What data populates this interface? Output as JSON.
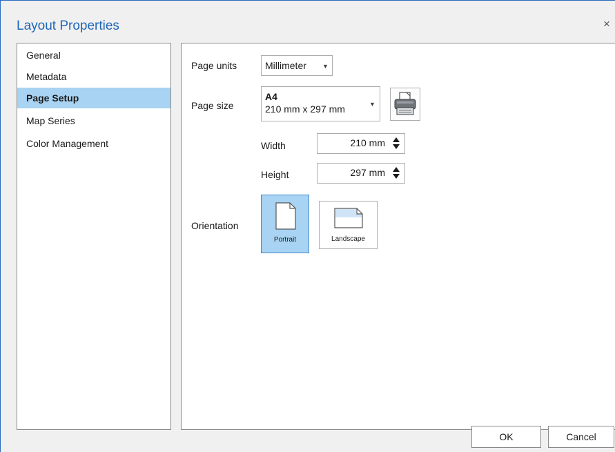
{
  "window": {
    "title": "Layout Properties",
    "close_glyph": "×"
  },
  "nav": {
    "items": [
      {
        "label": "General"
      },
      {
        "label": "Metadata"
      },
      {
        "label": "Page Setup",
        "selected": true
      },
      {
        "label": "Map Series"
      },
      {
        "label": "Color Management"
      }
    ]
  },
  "page_setup": {
    "units_label": "Page units",
    "units_value": "Millimeter",
    "size_label": "Page size",
    "size_name": "A4",
    "size_dims": "210 mm x 297 mm",
    "width_label": "Width",
    "width_value": "210 mm",
    "height_label": "Height",
    "height_value": "297 mm",
    "orientation_label": "Orientation",
    "portrait_label": "Portrait",
    "landscape_label": "Landscape",
    "selected_orientation": "Portrait"
  },
  "footer": {
    "ok_label": "OK",
    "cancel_label": "Cancel"
  },
  "colors": {
    "accent": "#1f66b8",
    "selection": "#a8d3f2"
  }
}
